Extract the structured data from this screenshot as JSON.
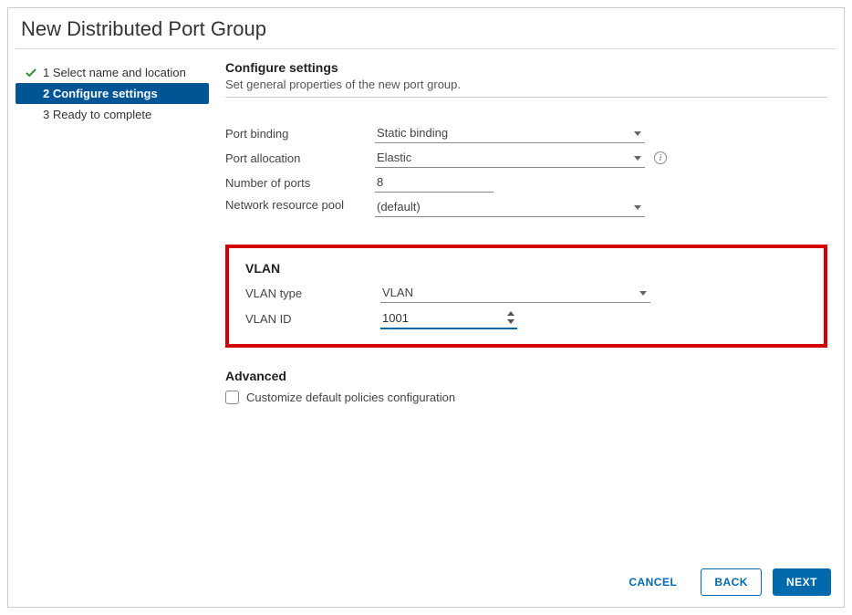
{
  "dialog": {
    "title": "New Distributed Port Group"
  },
  "steps": [
    {
      "label": "1 Select name and location",
      "completed": true,
      "active": false
    },
    {
      "label": "2 Configure settings",
      "completed": false,
      "active": true
    },
    {
      "label": "3 Ready to complete",
      "completed": false,
      "active": false
    }
  ],
  "section": {
    "title": "Configure settings",
    "subtitle": "Set general properties of the new port group."
  },
  "labels": {
    "port_binding": "Port binding",
    "port_allocation": "Port allocation",
    "number_of_ports": "Number of ports",
    "network_resource_pool": "Network resource pool",
    "vlan_group": "VLAN",
    "vlan_type": "VLAN type",
    "vlan_id": "VLAN ID",
    "advanced_group": "Advanced",
    "customize_checkbox": "Customize default policies configuration"
  },
  "values": {
    "port_binding": "Static binding",
    "port_allocation": "Elastic",
    "number_of_ports": "8",
    "network_resource_pool": "(default)",
    "vlan_type": "VLAN",
    "vlan_id": "1001"
  },
  "buttons": {
    "cancel": "CANCEL",
    "back": "BACK",
    "next": "NEXT"
  }
}
